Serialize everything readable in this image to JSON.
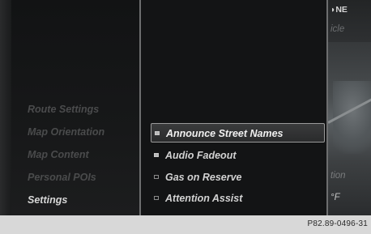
{
  "menu": {
    "items": [
      {
        "label": "Route Settings",
        "active": false
      },
      {
        "label": "Map Orientation",
        "active": false
      },
      {
        "label": "Map Content",
        "active": false
      },
      {
        "label": "Personal POIs",
        "active": false
      },
      {
        "label": "Settings",
        "active": true
      }
    ]
  },
  "options": {
    "items": [
      {
        "label": "Announce Street Names",
        "checked": true,
        "selected": true
      },
      {
        "label": "Audio Fadeout",
        "checked": true,
        "selected": false
      },
      {
        "label": "Gas on Reserve",
        "checked": false,
        "selected": false
      },
      {
        "label": "Attention Assist",
        "checked": false,
        "selected": false
      }
    ]
  },
  "map": {
    "compass": "NE",
    "vehicle_text": "icle",
    "info_text": "tion",
    "temperature_text": "°F"
  },
  "footer": {
    "figure_code": "P82.89-0496-31"
  },
  "colors": {
    "screen_bg": "#0e0f10",
    "active_text": "#d7d7d7",
    "inactive_text": "#4a4b4c",
    "separator": "#6d6e6f"
  }
}
